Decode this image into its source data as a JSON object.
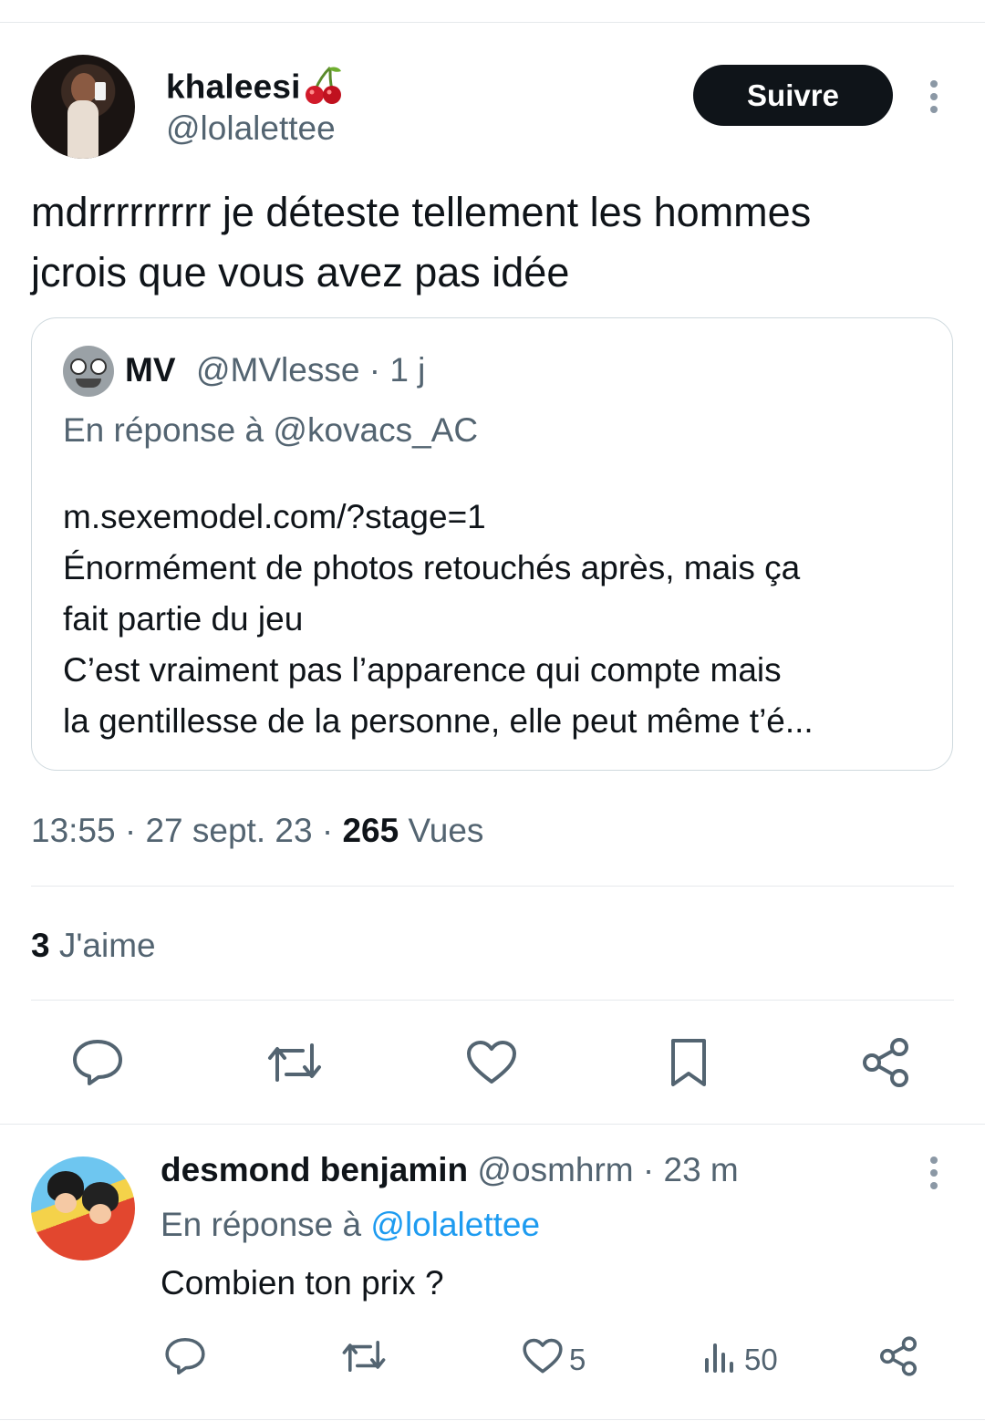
{
  "tweet": {
    "display_name": "khaleesi",
    "name_emoji": "🍒",
    "handle": "@lolalettee",
    "follow_label": "Suivre",
    "text_line1": "mdrrrrrrrrr je déteste tellement les hommes",
    "text_line2": "jcrois que vous avez pas idée",
    "quote": {
      "name": "MV",
      "handle_time": "@MVlesse · 1 j",
      "reply_to": "En réponse à @kovacs_AC",
      "lines": [
        "m.sexemodel.com/?stage=1",
        "Énormément de photos retouchés après, mais ça",
        "fait partie du jeu",
        "C’est vraiment pas l’apparence qui compte mais",
        "la gentillesse de la personne, elle peut même t’é..."
      ]
    },
    "time_date": "13:55 · 27 sept. 23 · ",
    "views_count": "265",
    "views_label": " Vues",
    "likes_count": "3",
    "likes_label": " J'aime",
    "actions": [
      "reply-icon",
      "retweet-icon",
      "like-icon",
      "bookmark-icon",
      "share-icon"
    ]
  },
  "reply": {
    "name": "desmond benjamin",
    "handle_time": " @osmhrm · 23 m",
    "reply_prefix": "En réponse à ",
    "reply_to": "@lolalettee",
    "text": "Combien ton prix ?",
    "like_count": "5",
    "views_count": "50"
  },
  "colors": {
    "text": "#0f1419",
    "secondary": "#536471",
    "link": "#1d9bf0",
    "border": "#cfd9de"
  }
}
